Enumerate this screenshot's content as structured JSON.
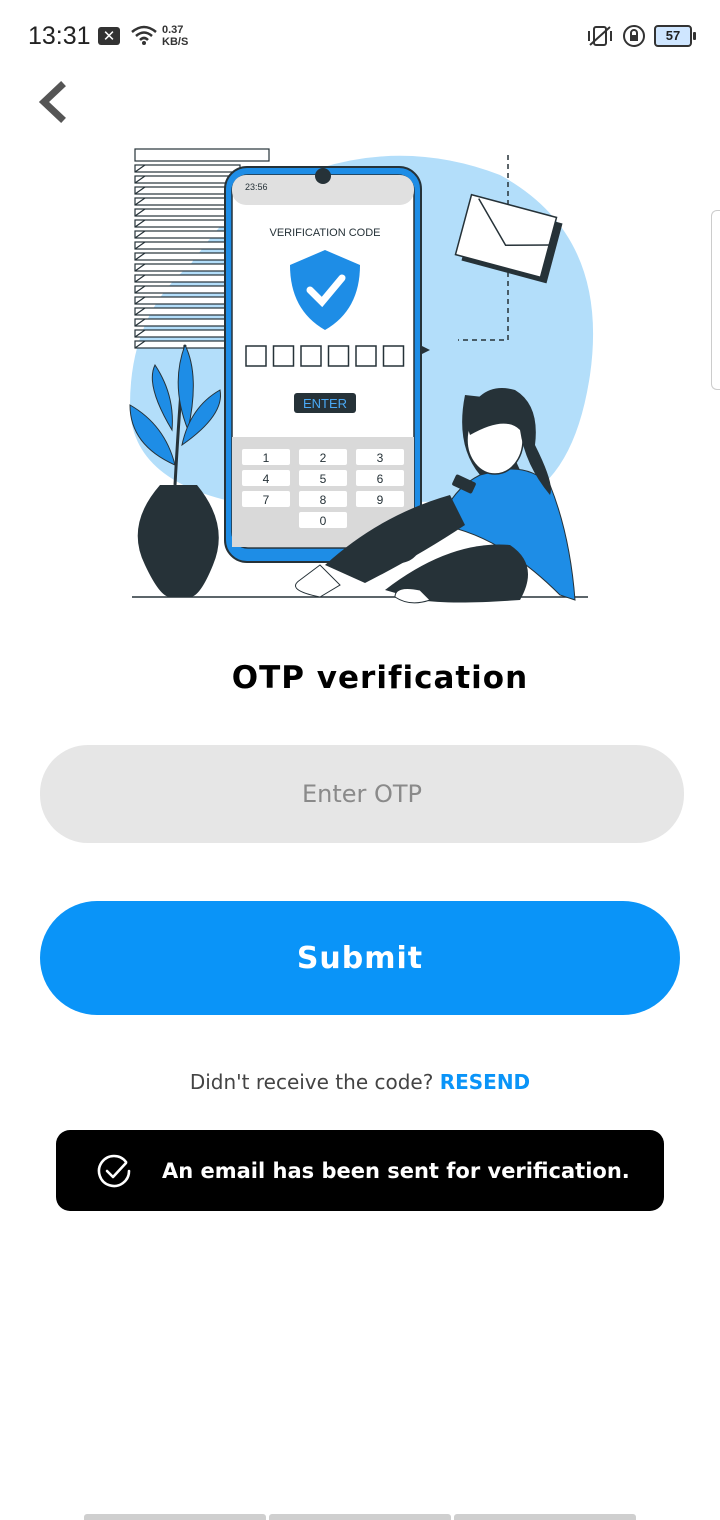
{
  "status_bar": {
    "time": "13:31",
    "net_speed_value": "0.37",
    "net_speed_unit": "KB/S",
    "battery": "57"
  },
  "back_button_icon": "chevron-left-icon",
  "illustration": {
    "phone_time": "23:56",
    "screen_title": "VERIFICATION CODE",
    "enter_label": "ENTER",
    "keys": [
      "1",
      "2",
      "3",
      "4",
      "5",
      "6",
      "7",
      "8",
      "9",
      "0"
    ],
    "colors": {
      "blob": "#b3defa",
      "accent": "#1e8de6",
      "dark": "#263238"
    }
  },
  "page": {
    "title": "OTP verification",
    "otp_placeholder": "Enter OTP",
    "otp_value": "",
    "submit_label": "Submit",
    "resend_prompt": "Didn't receive the code?",
    "resend_link": "RESEND"
  },
  "toast": {
    "icon": "check-circle-icon",
    "message": "An email has been sent for verification."
  },
  "colors": {
    "accent": "#0a94f8",
    "input_bg": "#e6e6e6",
    "toast_bg": "#000000"
  }
}
